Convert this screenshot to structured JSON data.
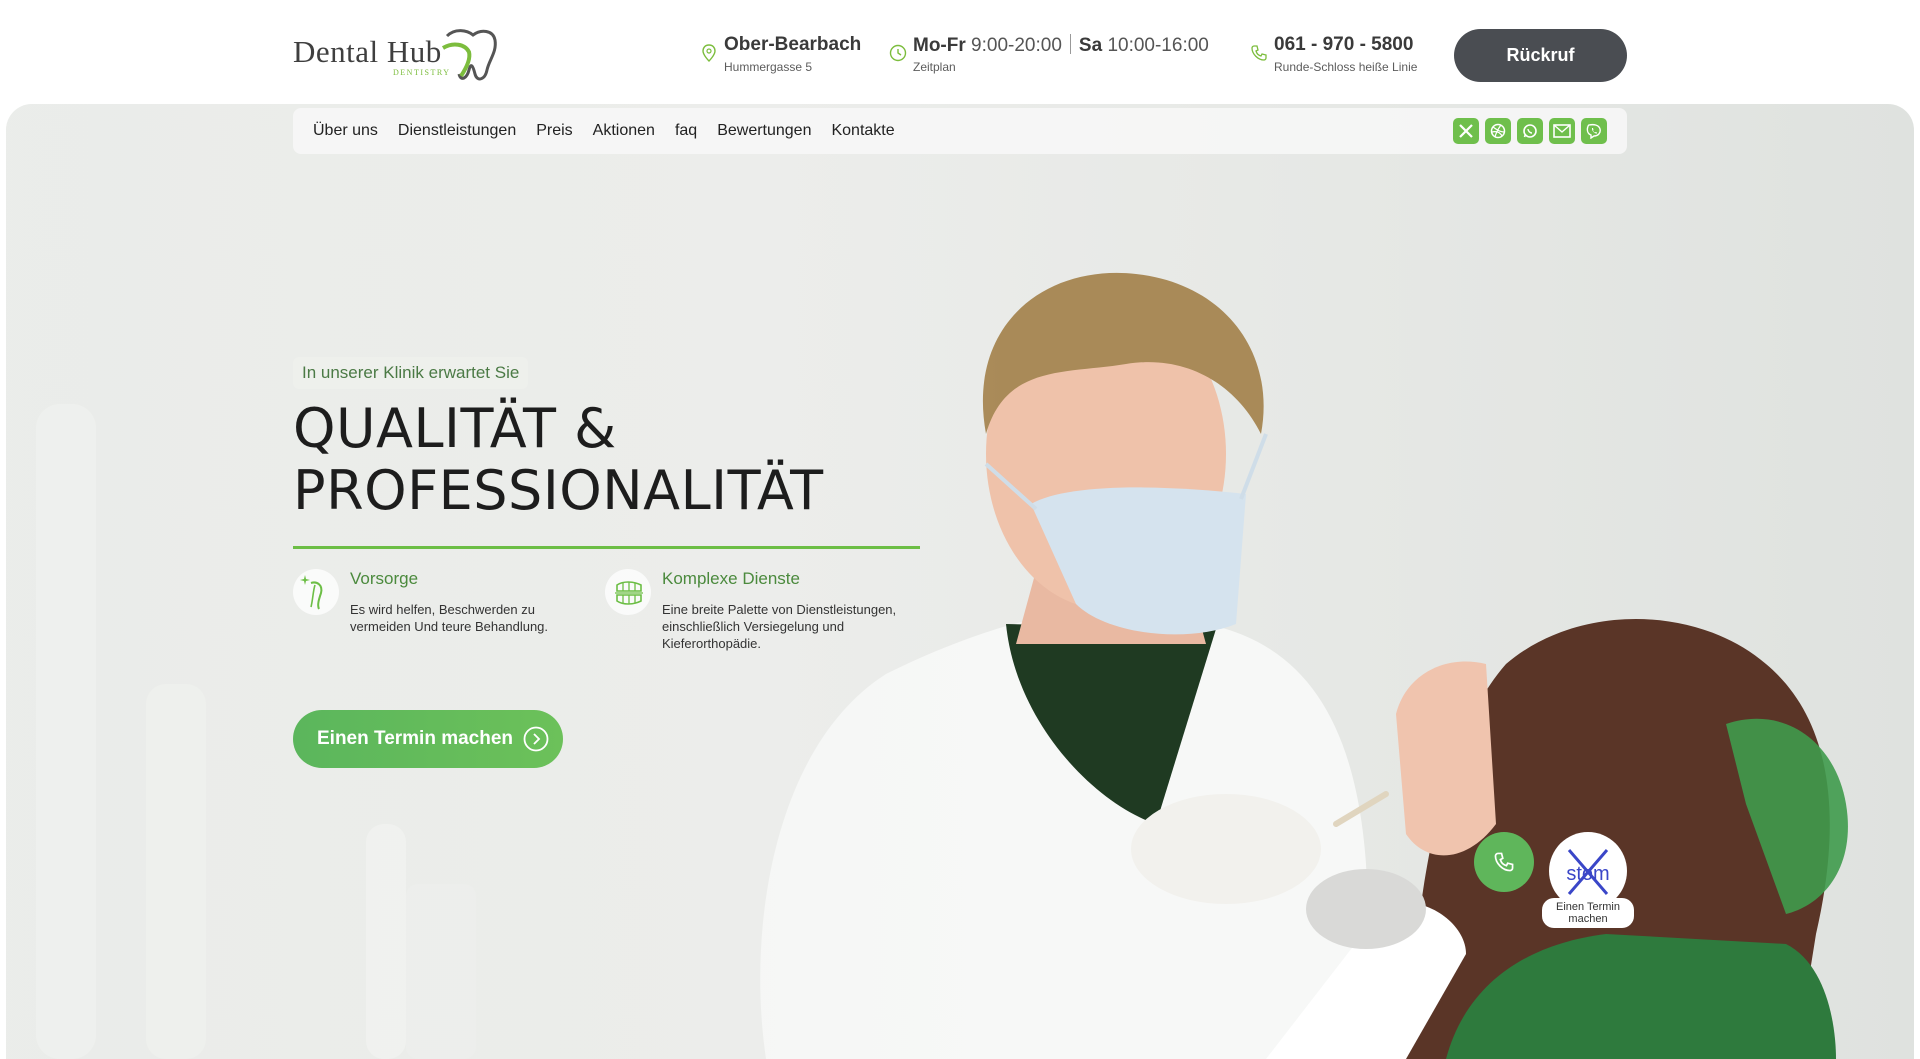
{
  "header": {
    "logo": {
      "name": "Dental Hub",
      "subtitle": "DENTISTRY"
    },
    "location": {
      "city": "Ober-Bearbach",
      "street": "Hummergasse 5"
    },
    "hours": {
      "weekday_label": "Mo-Fr",
      "weekday_hours": "9:00-20:00",
      "saturday_label": "Sa",
      "saturday_hours": "10:00-16:00",
      "caption": "Zeitplan"
    },
    "phone": {
      "number": "061 - 970 - 5800",
      "caption": "Runde-Schloss heiße Linie"
    },
    "callback_label": "Rückruf"
  },
  "nav": {
    "items": [
      {
        "label": "Über uns"
      },
      {
        "label": "Dienstleistungen"
      },
      {
        "label": "Preis"
      },
      {
        "label": "Aktionen"
      },
      {
        "label": "faq"
      },
      {
        "label": "Bewertungen"
      },
      {
        "label": "Kontakte"
      }
    ],
    "socials": [
      "x-icon",
      "dribbble-icon",
      "whatsapp-icon",
      "mail-icon",
      "viber-icon"
    ]
  },
  "hero": {
    "tagline": "In unserer Klinik erwartet Sie",
    "headline_line1": "QUALITÄT &",
    "headline_line2": "PROFESSIONALITÄT",
    "features": [
      {
        "title": "Vorsorge",
        "text": "Es wird helfen, Beschwerden zu vermeiden Und teure Behandlung.",
        "icon": "tooth-sparkle-icon"
      },
      {
        "title": "Komplexe Dienste",
        "text": "Eine breite Palette von Dienstleistungen, einschließlich Versiegelung und Kieferorthopädie.",
        "icon": "teeth-braces-icon"
      }
    ],
    "cta_label": "Einen Termin machen"
  },
  "floating": {
    "call_icon": "phone-icon",
    "book_logo": "stom",
    "book_label": "Einen Termin machen"
  },
  "colors": {
    "accent": "#6cbe45",
    "dark_button": "#4a4d52"
  }
}
